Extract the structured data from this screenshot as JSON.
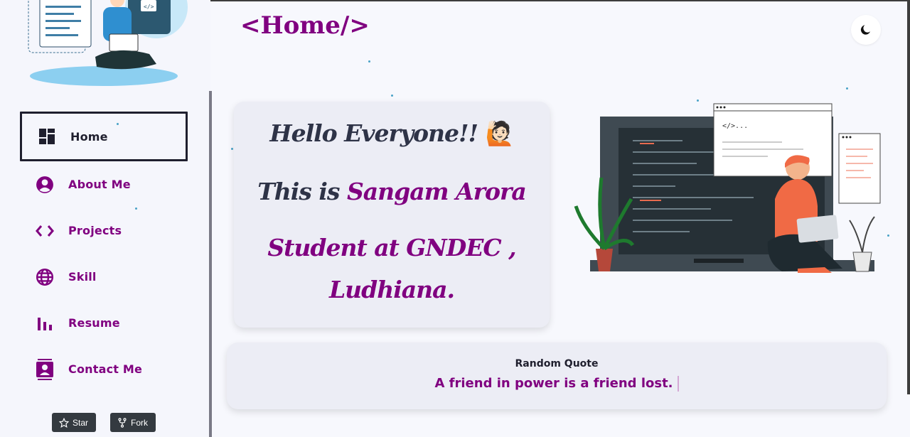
{
  "page": {
    "title": "<Home/>"
  },
  "nav": {
    "items": [
      {
        "label": "Home",
        "icon": "dashboard-icon",
        "active": true
      },
      {
        "label": "About Me",
        "icon": "user-circle-icon"
      },
      {
        "label": "Projects",
        "icon": "code-icon"
      },
      {
        "label": "Skill",
        "icon": "globe-icon"
      },
      {
        "label": "Resume",
        "icon": "bar-chart-icon"
      },
      {
        "label": "Contact Me",
        "icon": "contact-card-icon"
      }
    ]
  },
  "github": {
    "star_label": "Star",
    "fork_label": "Fork"
  },
  "intro": {
    "greeting": "Hello Everyone!!",
    "greeting_emoji": "🙋🏻",
    "this_is": "This is ",
    "name": "Sangam Arora",
    "role_line1": "Student at GNDEC ,",
    "role_line2": "Ludhiana."
  },
  "quote": {
    "heading": "Random Quote",
    "text": "A friend in power is a friend lost."
  },
  "colors": {
    "accent": "#800080",
    "dark_text": "#2e3347",
    "background": "#f7f8fd"
  }
}
